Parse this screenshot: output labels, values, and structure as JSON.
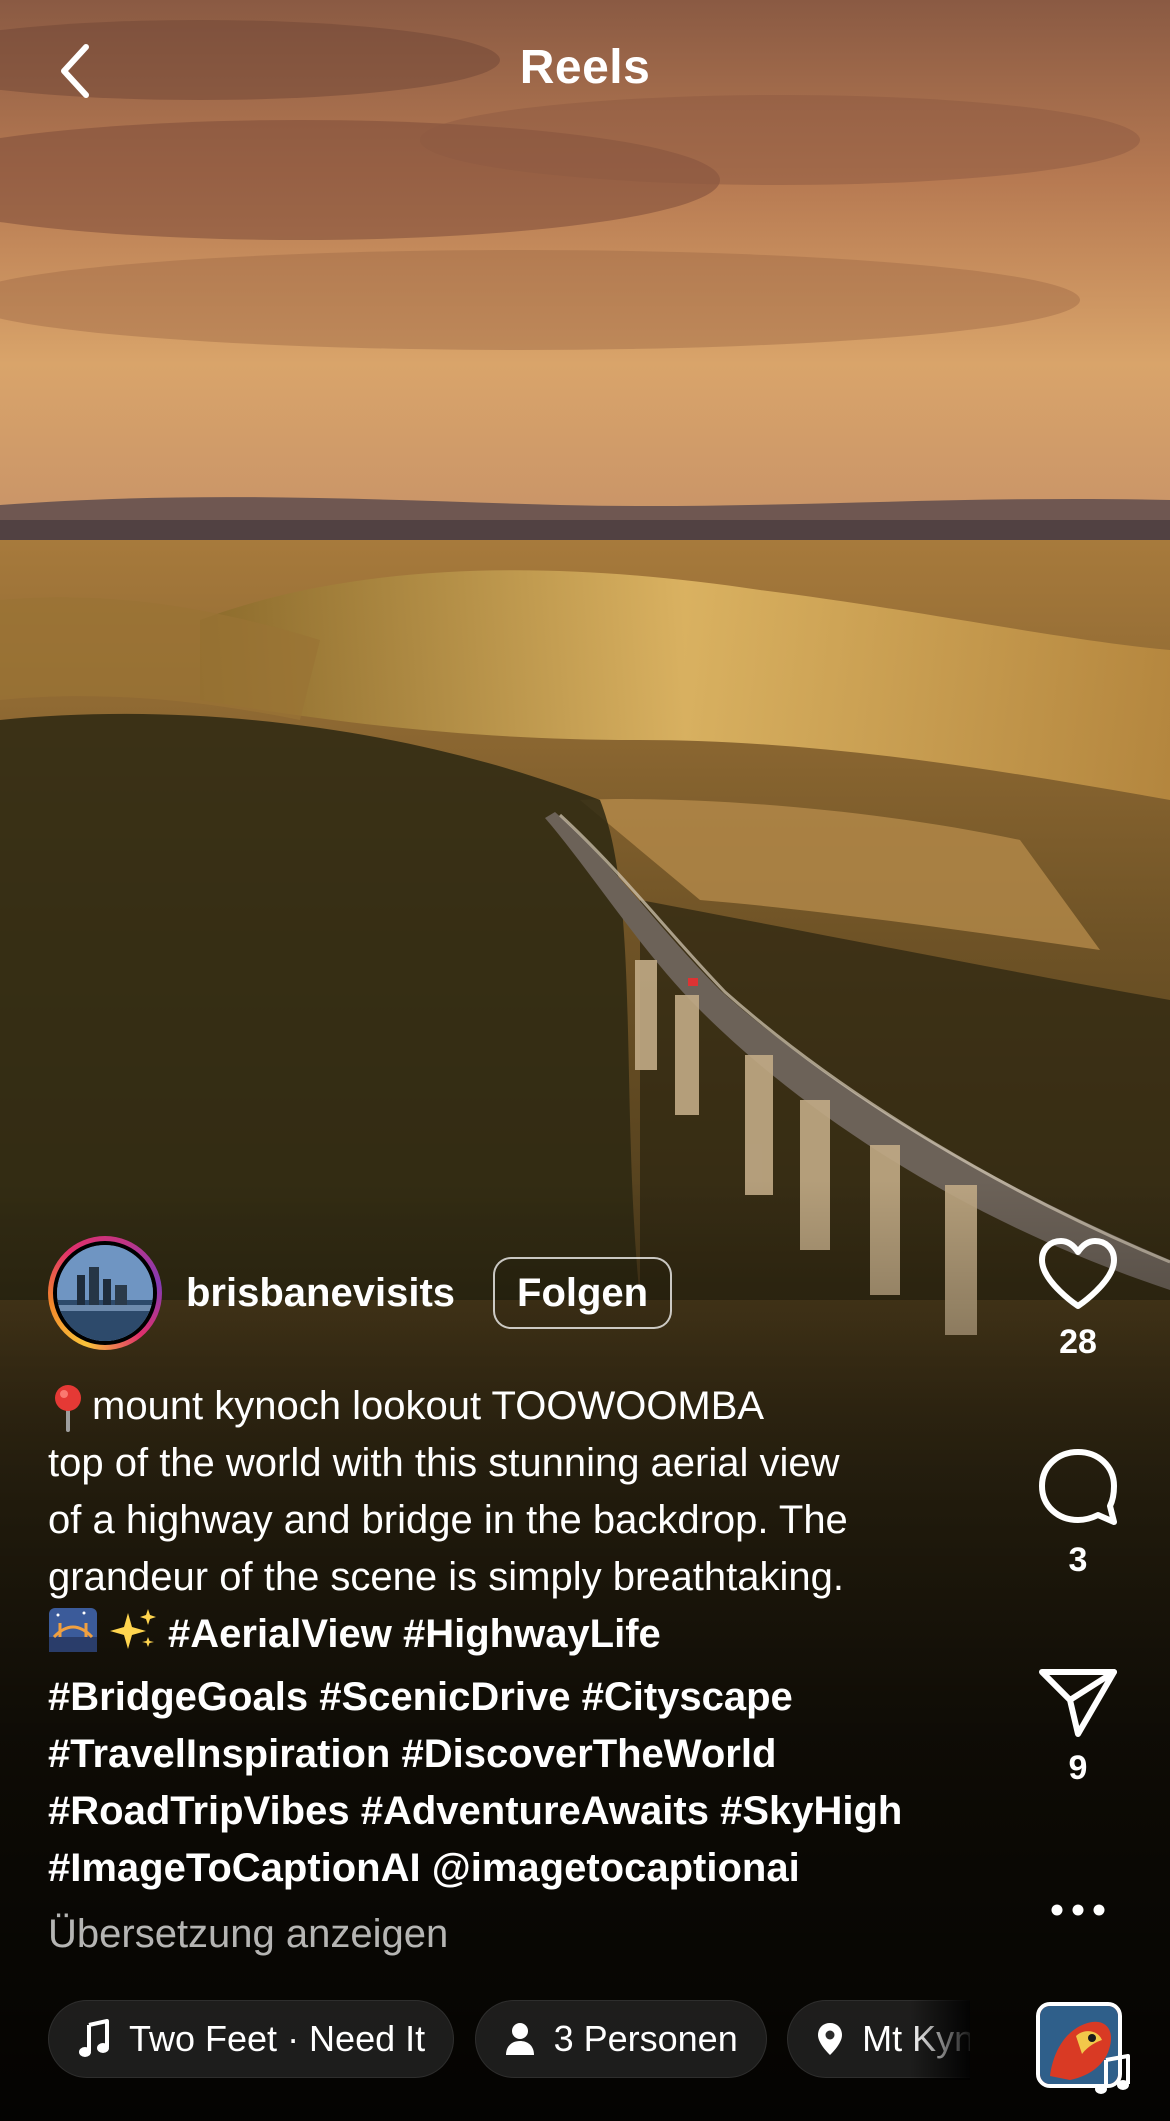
{
  "header": {
    "title": "Reels"
  },
  "post": {
    "author": "brisbanevisits",
    "follow_label": "Folgen",
    "caption_location": "mount kynoch lookout TOOWOOMBA",
    "caption_lines": [
      "top of the world with this stunning aerial view",
      "of a highway and bridge in the backdrop. The",
      "grandeur of the scene is simply breathtaking."
    ],
    "hashtag_lines": [
      "#AerialView #HighwayLife",
      "#BridgeGoals #ScenicDrive #Cityscape",
      "#TravelInspiration #DiscoverTheWorld",
      "#RoadTripVibes #AdventureAwaits #SkyHigh",
      "#ImageToCaptionAI @imagetocaptionai"
    ],
    "translate_label": "Übersetzung anzeigen"
  },
  "chips": [
    {
      "icon": "music-note-icon",
      "label": "Two Feet · Need It"
    },
    {
      "icon": "person-icon",
      "label": "3 Personen"
    },
    {
      "icon": "location-pin-icon",
      "label": "Mt Kynoch"
    }
  ],
  "actions": {
    "likes": "28",
    "comments": "3",
    "shares": "9"
  },
  "icons": [
    "back-chevron-icon",
    "heart-icon",
    "comment-icon",
    "share-icon",
    "more-icon",
    "music-note-icon"
  ]
}
